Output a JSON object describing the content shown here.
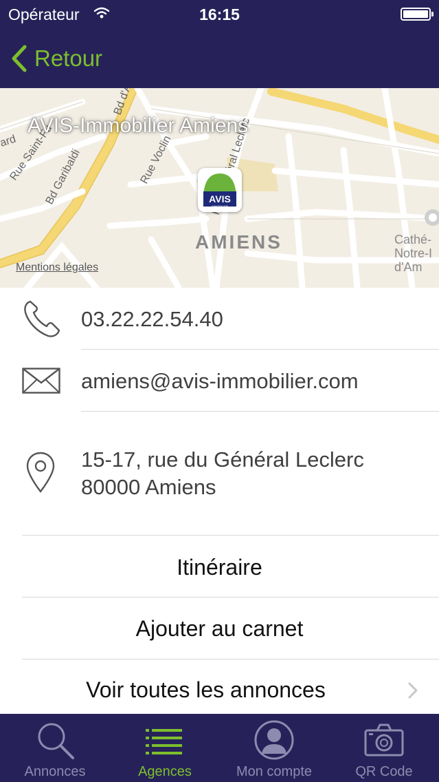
{
  "status_bar": {
    "carrier": "Opérateur",
    "time": "16:15"
  },
  "nav": {
    "back_label": "Retour",
    "accent_color": "#7dbe2d",
    "bar_color": "#262259"
  },
  "map": {
    "title": "AVIS-Immobilier Amiens",
    "city_label": "AMIENS",
    "legal_link": "Mentions légales",
    "poi_label": "Cathé- Notre-I d'Am",
    "street_labels": [
      "Bd d'A",
      "Rue Saint-Fu",
      "Bd Garibaldi",
      "Rue Voclin",
      "Rue Général Leclerc",
      "ard"
    ],
    "marker_logo": "AVIS IMMOBILIER"
  },
  "contact": {
    "phone": "03.22.22.54.40",
    "email": "amiens@avis-immobilier.com",
    "address_line1": "15-17, rue du Général Leclerc",
    "address_line2": "80000 Amiens"
  },
  "actions": {
    "itinerary": "Itinéraire",
    "add_contact": "Ajouter au carnet",
    "view_listings": "Voir toutes les annonces"
  },
  "tabs": [
    {
      "label": "Annonces",
      "icon": "search-icon",
      "active": false
    },
    {
      "label": "Agences",
      "icon": "list-icon",
      "active": true
    },
    {
      "label": "Mon compte",
      "icon": "account-icon",
      "active": false
    },
    {
      "label": "QR Code",
      "icon": "camera-icon",
      "active": false
    }
  ]
}
